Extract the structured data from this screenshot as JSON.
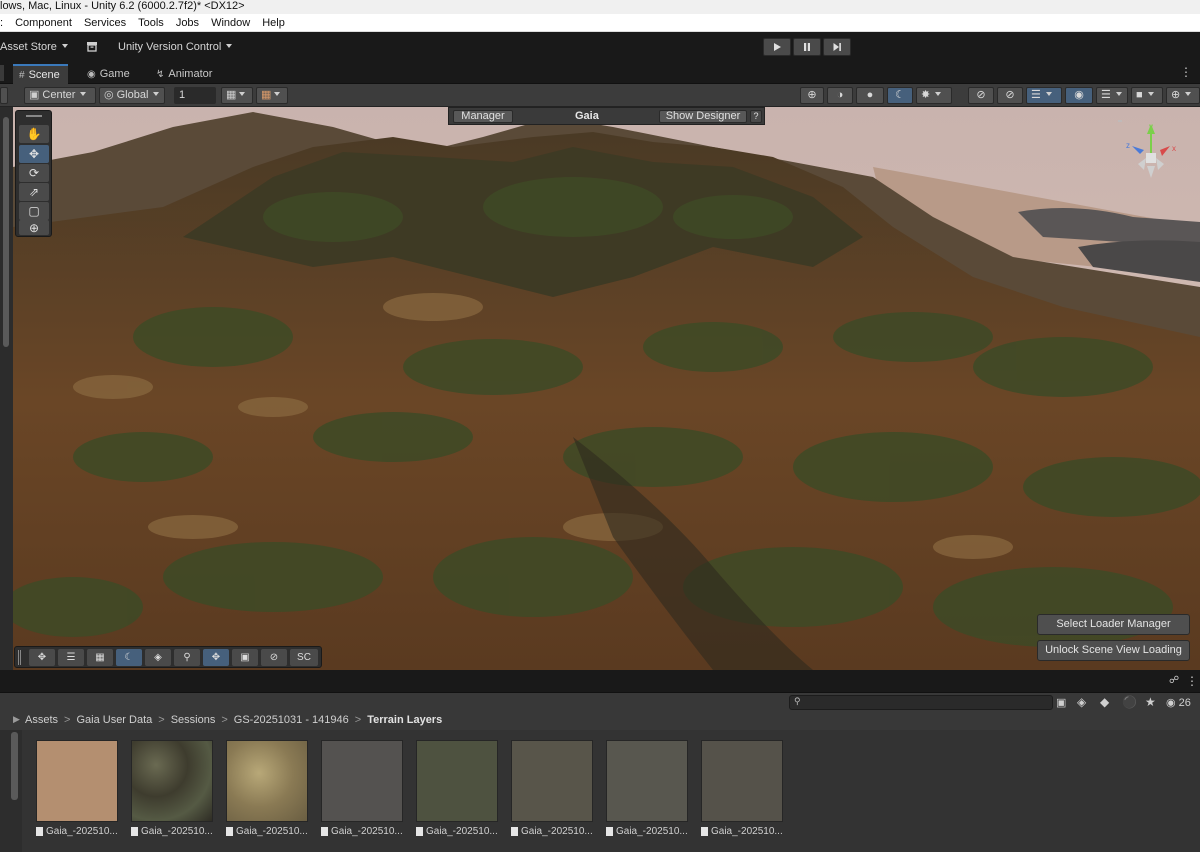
{
  "window": {
    "title": "lows, Mac, Linux - Unity 6.2 (6000.2.7f2)* <DX12>"
  },
  "menu": [
    "Component",
    "Services",
    "Tools",
    "Jobs",
    "Window",
    "Help"
  ],
  "main_toolbar": {
    "asset_store": "Asset Store",
    "version_control": "Unity Version Control"
  },
  "tabs": [
    {
      "label": "Scene",
      "active": true,
      "icon": "grid-icon"
    },
    {
      "label": "Game",
      "active": false,
      "icon": "gamepad-icon"
    },
    {
      "label": "Animator",
      "active": false,
      "icon": "animator-icon"
    }
  ],
  "scene_toolbar": {
    "pivot": "Center",
    "space": "Global",
    "grid_size": "1"
  },
  "gaia": {
    "manager_button": "Manager",
    "title": "Gaia",
    "designer_button": "Show Designer",
    "help_button": "?"
  },
  "overlay_toolbar": {
    "last_label": "SC"
  },
  "loader_buttons": {
    "select": "Select Loader Manager",
    "unlock": "Unlock Scene View Loading"
  },
  "project": {
    "breadcrumb": [
      "Assets",
      "Gaia User Data",
      "Sessions",
      "GS-20251031 - 141946",
      "Terrain Layers"
    ],
    "visibility_count": "26",
    "assets": [
      {
        "label": "Gaia_-202510...",
        "color": "#b48f70"
      },
      {
        "label": "Gaia_-202510...",
        "color": "#4c4a3a"
      },
      {
        "label": "Gaia_-202510...",
        "color": "#9e9068"
      },
      {
        "label": "Gaia_-202510...",
        "color": "#545250"
      },
      {
        "label": "Gaia_-202510...",
        "color": "#4e5240"
      },
      {
        "label": "Gaia_-202510...",
        "color": "#58554a"
      },
      {
        "label": "Gaia_-202510...",
        "color": "#58574f"
      },
      {
        "label": "Gaia_-202510...",
        "color": "#55524a"
      }
    ]
  }
}
